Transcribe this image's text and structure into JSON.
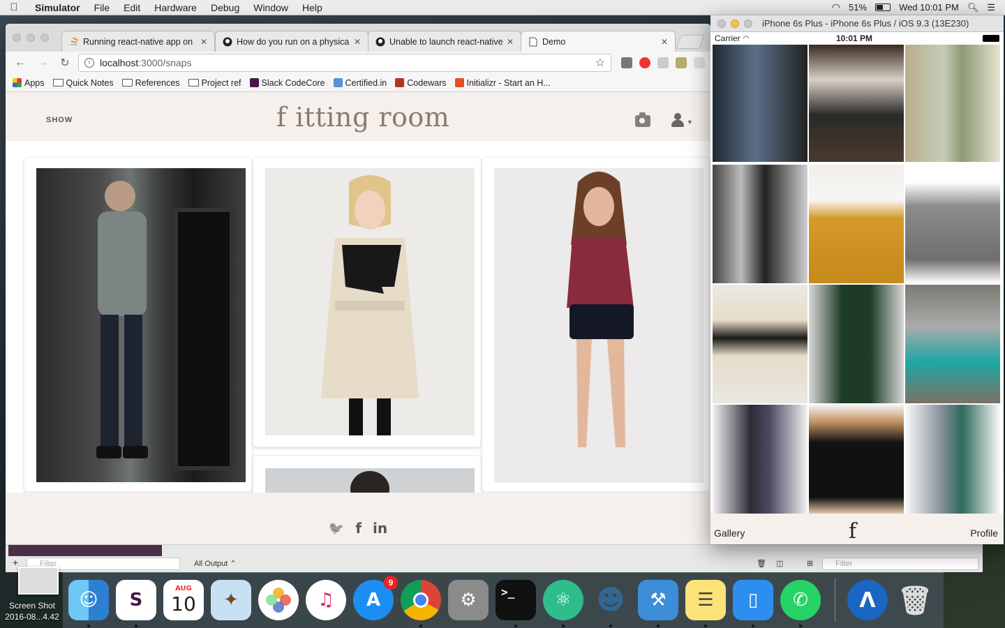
{
  "menubar": {
    "app": "Simulator",
    "items": [
      "File",
      "Edit",
      "Hardware",
      "Debug",
      "Window",
      "Help"
    ],
    "battery": "51%",
    "clock": "Wed 10:01 PM"
  },
  "browser": {
    "tabs": [
      {
        "title": "Running react-native app on"
      },
      {
        "title": "How do you run on a physica"
      },
      {
        "title": "Unable to launch react-native"
      },
      {
        "title": "Demo"
      }
    ],
    "url_host": "localhost",
    "url_rest": ":3000/snaps",
    "bookmarks": [
      "Apps",
      "Quick Notes",
      "References",
      "Project ref",
      "Slack CodeCore",
      "Certified.in",
      "Codewars",
      "Initializr - Start an H..."
    ]
  },
  "site": {
    "nav_show": "SHOW",
    "logo": "f itting room",
    "footer_icons": [
      "twitter-icon",
      "facebook-icon",
      "linkedin-icon"
    ],
    "footer_glyphs": {
      "twitter": "🐦",
      "facebook": "f",
      "linkedin": "in"
    }
  },
  "xcode": {
    "filter_placeholder": "Filter",
    "output_label": "All Output ⌃"
  },
  "simulator": {
    "title": "iPhone 6s Plus - iPhone 6s Plus / iOS 9.3 (13E230)",
    "carrier": "Carrier",
    "time": "10:01 PM",
    "tab_gallery": "Gallery",
    "tab_profile": "Profile",
    "tab_mark": "f"
  },
  "dock": {
    "calendar_month": "AUG",
    "calendar_day": "10",
    "appstore_badge": "9",
    "desktop_label": "Screen Shot 2016-08...4.42"
  },
  "colors": {
    "site_header_bg": "#f6f0ec",
    "logo": "#8a7b6e",
    "sim_close": "#c8c8c8",
    "sim_min": "#f4bf4f",
    "sim_zoom": "#c8c8c8"
  }
}
